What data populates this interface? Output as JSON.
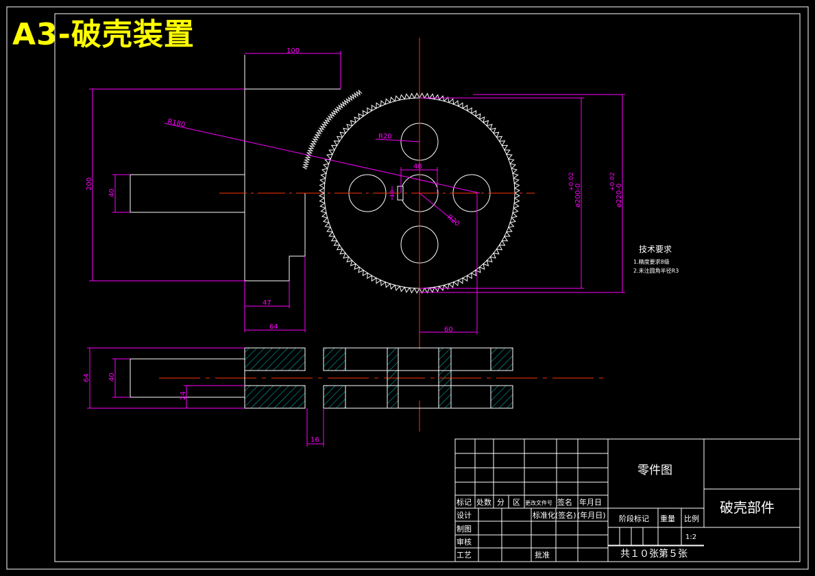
{
  "sheet": {
    "title": "A3-破壳装置",
    "colors": {
      "background": "#000000",
      "outline": "#ffffff",
      "dimension": "#ff00ff",
      "centerline": "#ff3300",
      "hatch": "#00cccc",
      "title": "#ffff00"
    }
  },
  "dimensions": {
    "d100": "100",
    "d200": "200",
    "d40_top": "40",
    "r180": "R180",
    "r20_top": "R20",
    "r20_mid": "R20",
    "d48": "48",
    "d10": "10",
    "d47": "47",
    "d64_top": "64",
    "d60": "60",
    "dia200": "ø200-0",
    "dia200_tol": "+0.02",
    "dia220": "ø220-0",
    "dia220_tol": "+0.02",
    "d64_side": "64",
    "d40_side": "40",
    "d24": "24",
    "d16": "16"
  },
  "tech_requirements": {
    "heading": "技术要求",
    "items": [
      "1.精度要求8级",
      "2.未注圆角半径R3"
    ]
  },
  "title_block": {
    "drawing_type": "零件图",
    "part_name": "破壳部件",
    "header": [
      "标记",
      "处数",
      "分",
      "区",
      "更改文件号",
      "签名",
      "年月日"
    ],
    "rows": [
      "设计",
      "制图",
      "审核",
      "工艺"
    ],
    "standardize": "标准化(签名)",
    "standardize_date": "(年月日)",
    "approve": "批准",
    "stage_mark": "阶段标记",
    "weight": "重量",
    "scale_label": "比例",
    "scale_value": "1:2",
    "sheet_count": "共１０张第５张"
  }
}
